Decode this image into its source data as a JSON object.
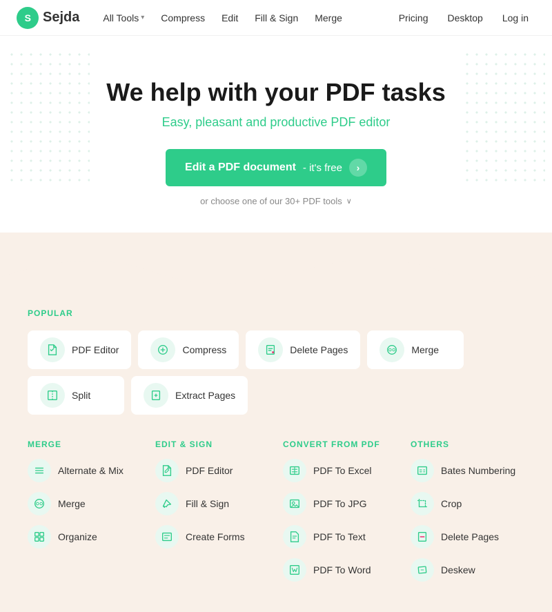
{
  "nav": {
    "logo_letter": "S",
    "logo_name": "Sejda",
    "links": [
      {
        "label": "All Tools",
        "has_arrow": true
      },
      {
        "label": "Compress",
        "has_arrow": false
      },
      {
        "label": "Edit",
        "has_arrow": false
      },
      {
        "label": "Fill & Sign",
        "has_arrow": false
      },
      {
        "label": "Merge",
        "has_arrow": false
      }
    ],
    "right_links": [
      {
        "label": "Pricing"
      },
      {
        "label": "Desktop"
      },
      {
        "label": "Log in"
      }
    ]
  },
  "hero": {
    "title": "We help with your PDF tasks",
    "subtitle": "Easy, pleasant and productive PDF editor",
    "cta_main": "Edit a PDF document",
    "cta_sub": "- it's free",
    "or_text": "or choose one of our 30+ PDF tools"
  },
  "popular": {
    "section_label": "POPULAR",
    "items": [
      {
        "label": "PDF Editor"
      },
      {
        "label": "Compress"
      },
      {
        "label": "Delete Pages"
      },
      {
        "label": "Merge"
      },
      {
        "label": "Split"
      },
      {
        "label": "Extract Pages"
      }
    ]
  },
  "categories": [
    {
      "label": "MERGE",
      "items": [
        {
          "label": "Alternate & Mix"
        },
        {
          "label": "Merge"
        },
        {
          "label": "Organize"
        }
      ]
    },
    {
      "label": "EDIT & SIGN",
      "items": [
        {
          "label": "PDF Editor"
        },
        {
          "label": "Fill & Sign"
        },
        {
          "label": "Create Forms"
        }
      ]
    },
    {
      "label": "CONVERT FROM PDF",
      "items": [
        {
          "label": "PDF To Excel"
        },
        {
          "label": "PDF To JPG"
        },
        {
          "label": "PDF To Text"
        },
        {
          "label": "PDF To Word"
        }
      ]
    },
    {
      "label": "OTHERS",
      "items": [
        {
          "label": "Bates Numbering"
        },
        {
          "label": "Crop"
        },
        {
          "label": "Delete Pages"
        },
        {
          "label": "Deskew"
        }
      ]
    }
  ],
  "colors": {
    "green": "#2ecc8a",
    "bg_warm": "#f9f0e8"
  }
}
